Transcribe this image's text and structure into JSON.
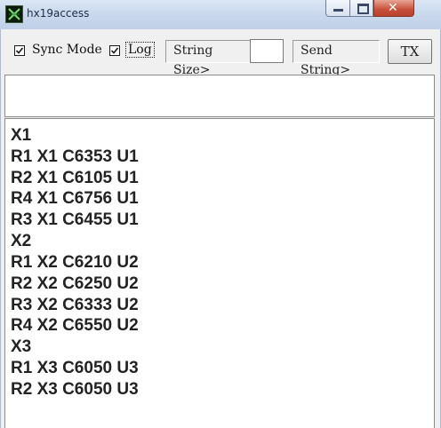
{
  "window": {
    "title": "hx19access"
  },
  "toolbar": {
    "sync_mode_label": "Sync Mode",
    "sync_mode_checked": true,
    "log_label": "Log",
    "log_checked": true,
    "string_size_label": "String Size>",
    "string_size_value": "",
    "send_string_label": "Send String>",
    "tx_label": "TX"
  },
  "input": {
    "value": ""
  },
  "log": {
    "lines": [
      "X1",
      "R1 X1 C6353 U1",
      "R2 X1 C6105 U1",
      "R4 X1 C6756 U1",
      "R3 X1 C6455 U1",
      "X2",
      "R1 X2 C6210 U2",
      "R2 X2 C6250 U2",
      "R3 X2 C6333 U2",
      "R4 X2 C6550 U2",
      "X3",
      "R1 X3 C6050 U3",
      "R2 X3 C6050 U3"
    ]
  }
}
